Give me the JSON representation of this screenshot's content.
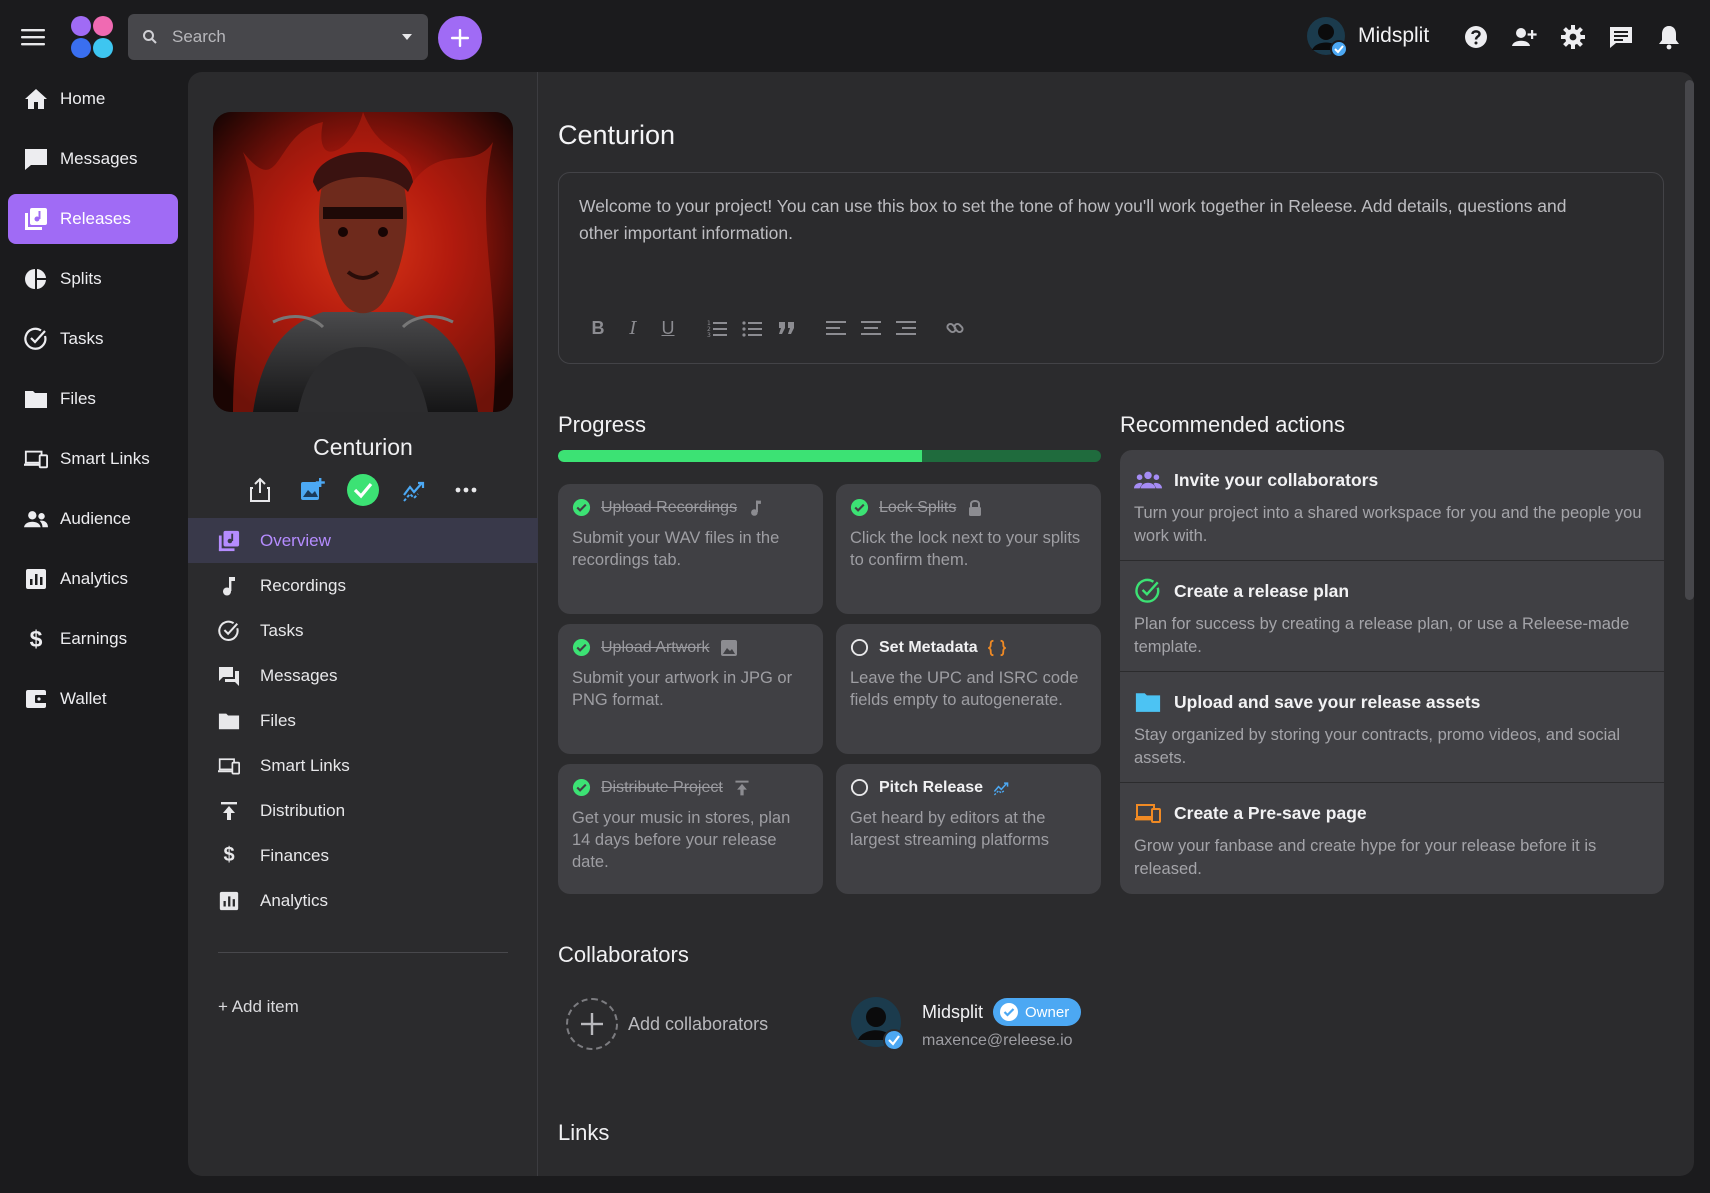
{
  "app": {
    "search_placeholder": "Search",
    "user_name": "Midsplit",
    "accent": "#a06bf5"
  },
  "topbar": {
    "icons": [
      "menu-icon",
      "help-icon",
      "add-user-icon",
      "settings-icon",
      "chat-icon",
      "bell-icon"
    ]
  },
  "nav": {
    "items": [
      {
        "label": "Home",
        "icon": "home-icon"
      },
      {
        "label": "Messages",
        "icon": "message-icon"
      },
      {
        "label": "Releases",
        "icon": "releases-icon",
        "active": true
      },
      {
        "label": "Splits",
        "icon": "pie-icon"
      },
      {
        "label": "Tasks",
        "icon": "check-circle-icon"
      },
      {
        "label": "Files",
        "icon": "folder-icon"
      },
      {
        "label": "Smart Links",
        "icon": "devices-icon"
      },
      {
        "label": "Audience",
        "icon": "people-icon"
      },
      {
        "label": "Analytics",
        "icon": "analytics-icon"
      },
      {
        "label": "Earnings",
        "icon": "dollar-icon"
      },
      {
        "label": "Wallet",
        "icon": "wallet-icon"
      }
    ]
  },
  "project": {
    "title": "Centurion",
    "menu": [
      {
        "label": "Overview",
        "active": true
      },
      {
        "label": "Recordings"
      },
      {
        "label": "Tasks"
      },
      {
        "label": "Messages"
      },
      {
        "label": "Files"
      },
      {
        "label": "Smart Links"
      },
      {
        "label": "Distribution"
      },
      {
        "label": "Finances"
      },
      {
        "label": "Analytics"
      }
    ],
    "add_item": "+ Add item"
  },
  "overview": {
    "title": "Centurion",
    "description": "Welcome to your project! You can use this box to set the tone of how you'll work together in Releese. Add details, questions and other important information.",
    "progress_title": "Progress",
    "progress_fraction": 0.67,
    "progress_cards": [
      {
        "title": "Upload Recordings",
        "desc": "Submit your WAV files in the recordings tab.",
        "done": true
      },
      {
        "title": "Lock Splits",
        "desc": "Click the lock next to your splits to confirm them.",
        "done": true
      },
      {
        "title": "Upload Artwork",
        "desc": "Submit your artwork in JPG or PNG format.",
        "done": true
      },
      {
        "title": "Set Metadata",
        "desc": "Leave the UPC and ISRC code fields empty to autogenerate.",
        "done": false
      },
      {
        "title": "Distribute Project",
        "desc": "Get your music in stores, plan 14 days before your release date.",
        "done": true
      },
      {
        "title": "Pitch Release",
        "desc": "Get heard by editors at the largest streaming platforms",
        "done": false
      }
    ],
    "recommended_title": "Recommended actions",
    "recommended": [
      {
        "title": "Invite your collaborators",
        "desc": "Turn your project into a shared workspace for you and the people you work with."
      },
      {
        "title": "Create a release plan",
        "desc": "Plan for success by creating a release plan, or use a Releese-made template."
      },
      {
        "title": "Upload and save your release assets",
        "desc": "Stay organized by storing your contracts, promo videos, and social assets."
      },
      {
        "title": "Create a Pre-save page",
        "desc": "Grow your fanbase and create hype for your release before it is released."
      }
    ],
    "collaborators_title": "Collaborators",
    "add_collaborators": "Add collaborators",
    "collaborator": {
      "name": "Midsplit",
      "role": "Owner",
      "email": "maxence@releese.io"
    },
    "links_title": "Links"
  }
}
